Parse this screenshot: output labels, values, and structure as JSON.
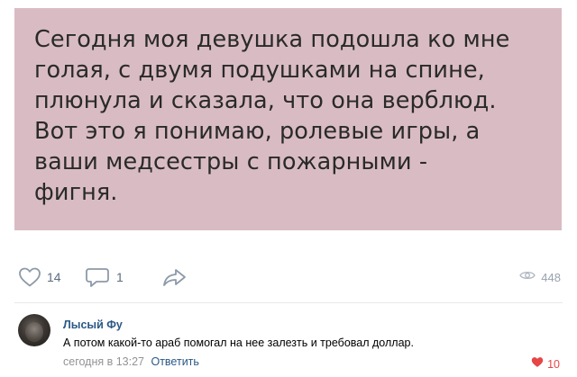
{
  "post": {
    "lines": [
      "Сегодня моя девушка подошла ко мне",
      "голая, с двумя подушками на спине,",
      "плюнула и сказала, что она верблюд.",
      "Вот это я понимаю, ролевые игры, а",
      "ваши медсестры с пожарными -",
      "фигня."
    ],
    "card_color": "#d9bcc3"
  },
  "actions": {
    "likes": "14",
    "comments": "1",
    "views": "448",
    "icons": [
      "heart-icon",
      "comment-icon",
      "share-icon",
      "eye-icon"
    ]
  },
  "comment": {
    "author": "Лысый Фу",
    "text": "А потом какой-то араб помогал на нее залезть и требовал доллар.",
    "time": "сегодня в 13:27",
    "reply_label": "Ответить",
    "likes": "10",
    "link_color": "#2a5885",
    "like_color": "#e64646"
  }
}
